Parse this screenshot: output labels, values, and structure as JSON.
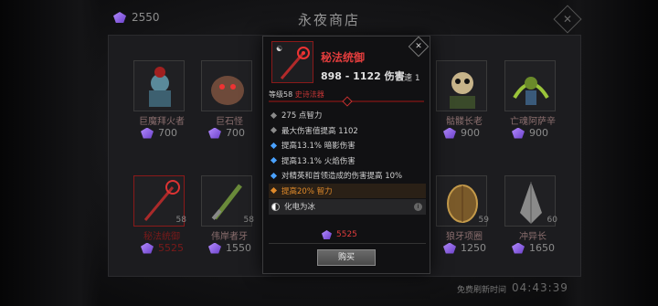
{
  "currency": {
    "amount": "2550"
  },
  "shop": {
    "title": "永夜商店"
  },
  "tiles_top": [
    {
      "name": "巨魔拜火者",
      "price": "700"
    },
    {
      "name": "巨石怪",
      "price": "700"
    },
    {
      "name": "骷髅长老",
      "price": "900"
    },
    {
      "name": "亡魂阿萨辛",
      "price": "900"
    }
  ],
  "tiles_bottom": [
    {
      "name": "秘法统御",
      "price": "5525",
      "level": "58"
    },
    {
      "name": "伟岸者牙",
      "price": "1550",
      "level": "58"
    },
    {
      "name": "狼牙项圈",
      "price": "1250",
      "level": "59"
    },
    {
      "name": "冲异长",
      "price": "1650",
      "level": "60"
    }
  ],
  "footer": {
    "refresh_label": "免费刷新时间",
    "timer": "04:43:39"
  },
  "popup": {
    "name": "秘法统御",
    "damage": "898 - 1122 伤害",
    "speed": "攻速 1",
    "level": "等级58",
    "type": "史诗法器",
    "stats": [
      {
        "text": "275 点智力",
        "kind": "plain"
      },
      {
        "text": "最大伤害值提高 1102",
        "kind": "plain"
      },
      {
        "text": "提高13.1% 暗影伤害",
        "kind": "blue"
      },
      {
        "text": "提高13.1% 火焰伤害",
        "kind": "blue"
      },
      {
        "text": "对精英和首领造成的伤害提高 10%",
        "kind": "blue"
      },
      {
        "text": "提高20% 智力",
        "kind": "orange"
      }
    ],
    "unique": "化电为冰",
    "price": "5525",
    "buy": "购买"
  },
  "colors": {
    "epic_red": "#e23d3d",
    "magic_blue": "#4aa2ff",
    "legendary_orange": "#e08a2a",
    "gem_purple": "#8a5ce0"
  }
}
